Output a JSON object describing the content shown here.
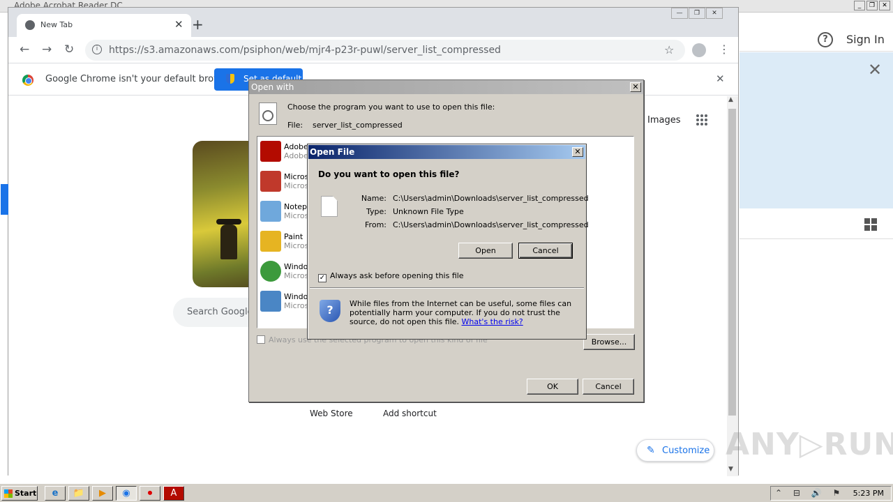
{
  "acrobat": {
    "title": "Adobe Acrobat Reader DC",
    "help": "?",
    "signin": "Sign In",
    "close": "✕",
    "win_min": "_",
    "win_restore": "❐",
    "win_close": "✕"
  },
  "chrome": {
    "tab_title": "New Tab",
    "tab_close": "✕",
    "new_tab": "+",
    "back": "←",
    "forward": "→",
    "reload": "↻",
    "info": "i",
    "url": "https://s3.amazonaws.com/psiphon/web/mjr4-p23r-puwl/server_list_compressed",
    "star": "☆",
    "menu": "⋮",
    "win_min": "—",
    "win_max": "❐",
    "win_close": "✕",
    "infobar": {
      "message": "Google Chrome isn't your default browser",
      "button": "Set as default",
      "close": "✕"
    },
    "newtab_page": {
      "images_link": "Images",
      "search_placeholder": "Search Google",
      "shortcut_webstore": "Web Store",
      "shortcut_add": "Add shortcut",
      "customize": "Customize",
      "customize_icon": "✎"
    }
  },
  "open_with": {
    "title": "Open with",
    "close": "✕",
    "prompt": "Choose the program you want to use to open this file:",
    "file_label": "File:",
    "file_name": "server_list_compressed",
    "programs": [
      {
        "name": "Adobe",
        "publisher": "Adobe",
        "color": "#b30b00"
      },
      {
        "name": "Microsoft",
        "publisher": "Microsoft",
        "color": "#c0392b"
      },
      {
        "name": "Notepad",
        "publisher": "Microsoft",
        "color": "#6fa8dc"
      },
      {
        "name": "Paint",
        "publisher": "Microsoft",
        "color": "#e6b422"
      },
      {
        "name": "Windows",
        "publisher": "Microsoft",
        "color": "#3c9a3c"
      },
      {
        "name": "Windows",
        "publisher": "Microsoft",
        "color": "#4a86c5"
      }
    ],
    "always_use": "Always use the selected program to open this kind of file",
    "browse": "Browse...",
    "ok": "OK",
    "cancel": "Cancel"
  },
  "open_file": {
    "title": "Open File",
    "close": "✕",
    "question": "Do you want to open this file?",
    "name_label": "Name:",
    "name_value": "C:\\Users\\admin\\Downloads\\server_list_compressed",
    "type_label": "Type:",
    "type_value": "Unknown File Type",
    "from_label": "From:",
    "from_value": "C:\\Users\\admin\\Downloads\\server_list_compressed",
    "open": "Open",
    "cancel": "Cancel",
    "always_ask": "Always ask before opening this file",
    "check_mark": "✓",
    "shield": "?",
    "warning": "While files from the Internet can be useful, some files can potentially harm your computer. If you do not trust the source, do not open this file.",
    "risk_link": "What's the risk?"
  },
  "taskbar": {
    "start": "Start",
    "items": [
      "e",
      "📁",
      "▶",
      "◉",
      "⏺",
      "A"
    ],
    "tray_icons": "⌃ ⊟ 🔊 ⚑",
    "time": "5:23 PM"
  },
  "watermark": "ANY▷RUN"
}
